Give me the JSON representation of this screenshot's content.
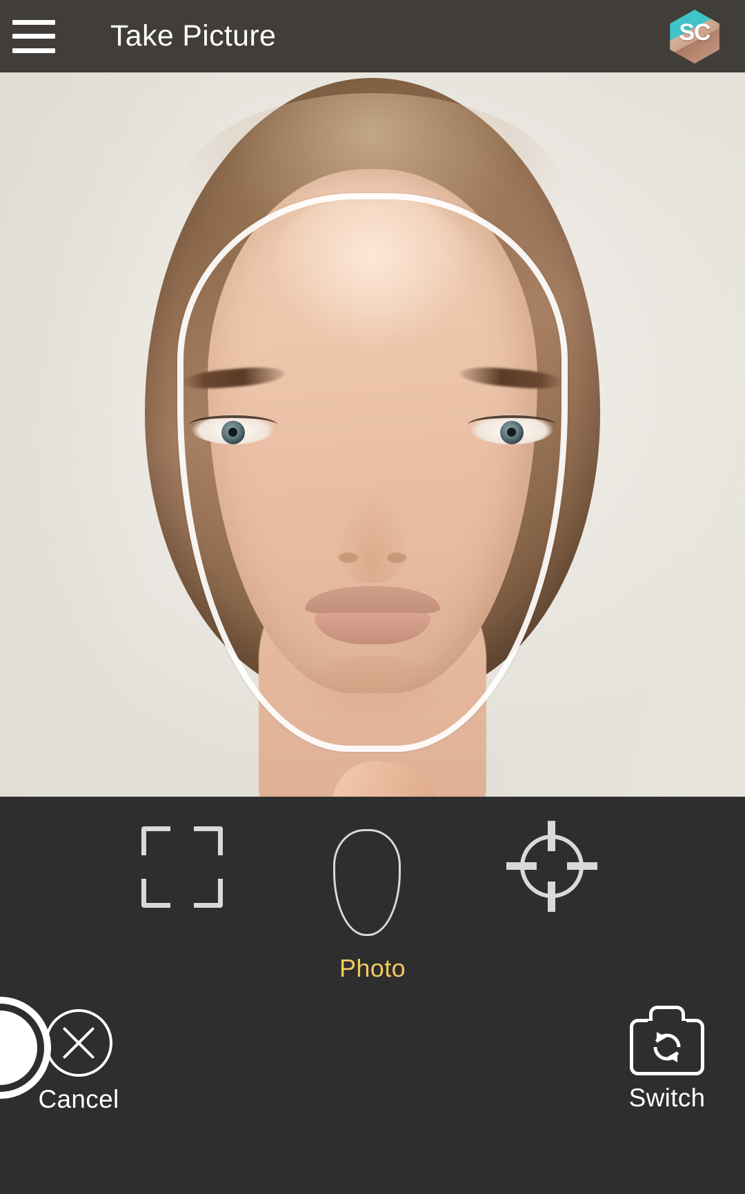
{
  "app": {
    "title": "Take Picture",
    "logo_mark": "SC",
    "logo_teal": "#3fc4c9"
  },
  "topbar": {
    "menu_icon": "hamburger-menu-icon",
    "logo_icon": "app-logo-icon"
  },
  "preview": {
    "overlay_guide": "face-outline-guide",
    "subject": "woman-portrait-front-facing"
  },
  "modes": [
    {
      "id": "crop",
      "icon": "crop-frame-icon",
      "label": ""
    },
    {
      "id": "face",
      "icon": "face-oval-icon",
      "label": ""
    },
    {
      "id": "target",
      "icon": "crosshair-target-icon",
      "label": ""
    }
  ],
  "mode_label": {
    "text": "Photo",
    "color": "#f0ca5e"
  },
  "actions": {
    "cancel": {
      "label": "Cancel",
      "icon": "cancel-circle-x-icon"
    },
    "shutter": {
      "label": "",
      "icon": "shutter-button-icon"
    },
    "switch": {
      "label": "Switch",
      "icon": "camera-switch-icon"
    }
  },
  "colors": {
    "topbar_bg": "#413e3a",
    "panel_bg": "#2e2e2e",
    "accent": "#f0ca5e",
    "icon": "#d9d9d9"
  }
}
